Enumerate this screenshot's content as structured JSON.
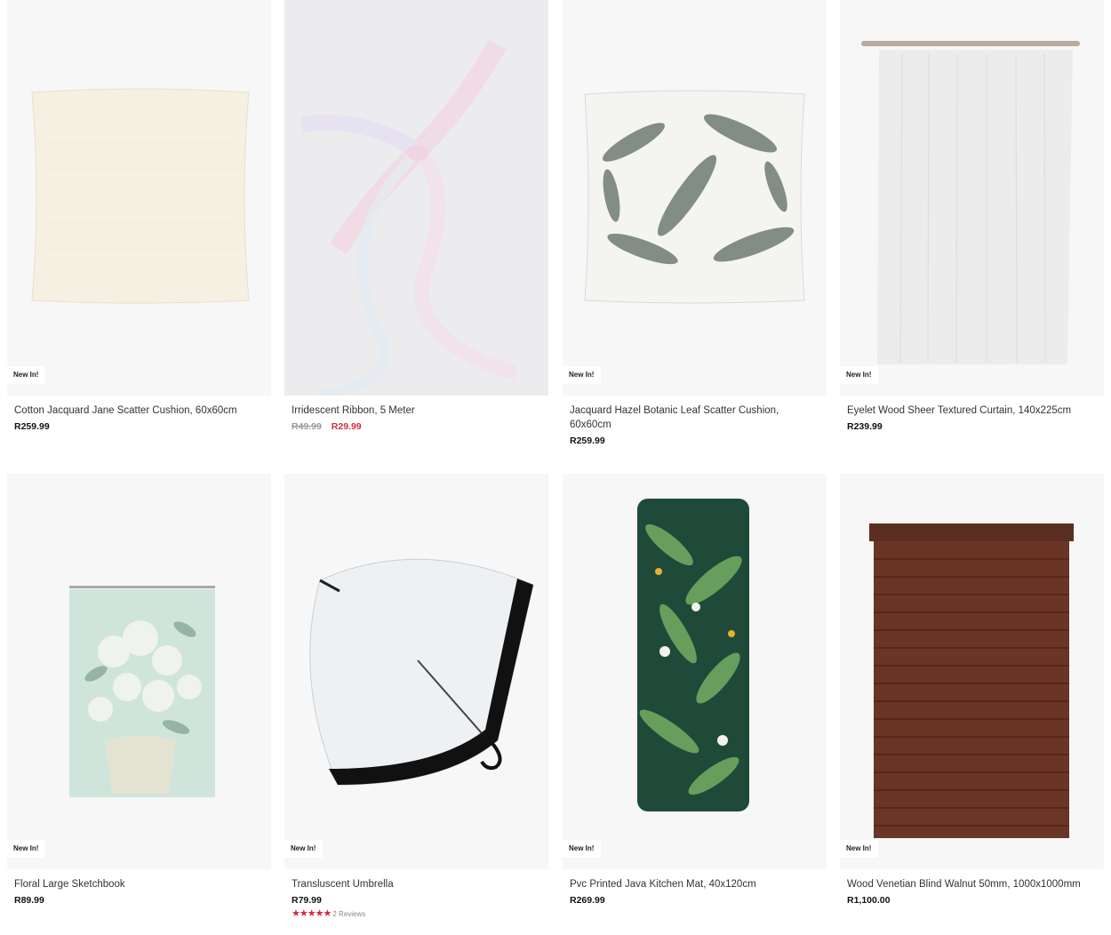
{
  "products": [
    {
      "title": "Cotton Jacquard Jane Scatter Cushion, 60x60cm",
      "price": "R259.99",
      "badge": "New In!",
      "image": "cream-cushion"
    },
    {
      "title": "Irridescent Ribbon, 5 Meter",
      "old_price": "R49.99",
      "sale_price": "R29.99",
      "image": "iridescent-ribbon"
    },
    {
      "title": "Jacquard Hazel Botanic Leaf Scatter Cushion, 60x60cm",
      "price": "R259.99",
      "badge": "New In!",
      "image": "leaf-cushion"
    },
    {
      "title": "Eyelet Wood Sheer Textured Curtain, 140x225cm",
      "price": "R239.99",
      "badge": "New In!",
      "image": "sheer-curtain"
    },
    {
      "title": "Floral Large Sketchbook",
      "price": "R89.99",
      "badge": "New In!",
      "image": "floral-sketchbook"
    },
    {
      "title": "Transluscent Umbrella",
      "price": "R79.99",
      "badge": "New In!",
      "image": "clear-umbrella",
      "rating": 5,
      "reviews": "2 Reviews"
    },
    {
      "title": "Pvc Printed Java Kitchen Mat, 40x120cm",
      "price": "R269.99",
      "badge": "New In!",
      "image": "tropical-mat"
    },
    {
      "title": "Wood Venetian Blind Walnut 50mm, 1000x1000mm",
      "price": "R1,100.00",
      "badge": "New In!",
      "image": "walnut-blind"
    }
  ],
  "colors": {
    "sale": "#d0303d",
    "star": "#d4283a",
    "tile": "#f7f7f7"
  }
}
